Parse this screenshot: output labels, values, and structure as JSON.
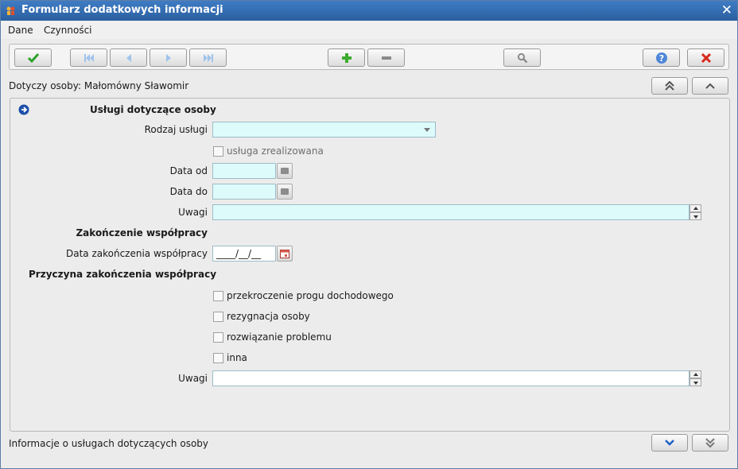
{
  "window": {
    "title": "Formularz dodatkowych informacji"
  },
  "menu": {
    "items": [
      {
        "label": "Dane"
      },
      {
        "label": "Czynności"
      }
    ]
  },
  "toolbar": {
    "buttons": [
      {
        "icon": "check-icon"
      },
      {
        "icon": "first-record-icon"
      },
      {
        "icon": "previous-record-icon"
      },
      {
        "icon": "next-record-icon"
      },
      {
        "icon": "last-record-icon"
      },
      {
        "icon": "add-icon"
      },
      {
        "icon": "remove-icon"
      },
      {
        "icon": "search-icon"
      },
      {
        "icon": "help-icon"
      },
      {
        "icon": "cancel-icon"
      }
    ]
  },
  "person": {
    "label": "Dotyczy osoby: Małomówny Sławomir"
  },
  "form": {
    "section_services": "Usługi dotyczące osoby",
    "service_type_label": "Rodzaj usługi",
    "service_type_value": "",
    "service_realized_label": "usługa zrealizowana",
    "date_from_label": "Data od",
    "date_from_value": "",
    "date_to_label": "Data do",
    "date_to_value": "",
    "notes_label": "Uwagi",
    "notes_value": "",
    "section_end": "Zakończenie współpracy",
    "end_date_label": "Data zakończenia współpracy",
    "end_date_value": "____/__/__",
    "section_reason": "Przyczyna zakończenia współpracy",
    "reasons": [
      {
        "label": "przekroczenie progu dochodowego",
        "checked": false
      },
      {
        "label": "rezygnacja osoby",
        "checked": false
      },
      {
        "label": "rozwiązanie problemu",
        "checked": false
      },
      {
        "label": "inna",
        "checked": false
      }
    ],
    "notes2_label": "Uwagi",
    "notes2_value": ""
  },
  "status": {
    "text": "Informacje o usługach dotyczących osoby"
  },
  "colors": {
    "title_bar": "#2e66ad",
    "field_fill": "#ddfbfb",
    "accept_green": "#2ca12c",
    "cancel_red": "#d8281c"
  }
}
